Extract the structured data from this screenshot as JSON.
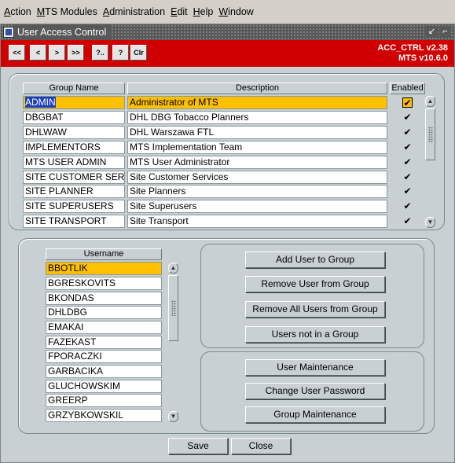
{
  "menu": [
    {
      "acc": "A",
      "rest": "ction"
    },
    {
      "acc": "M",
      "rest": "TS Modules"
    },
    {
      "acc": "A",
      "rest": "dministration"
    },
    {
      "acc": "E",
      "rest": "dit"
    },
    {
      "acc": "H",
      "rest": "elp"
    },
    {
      "acc": "W",
      "rest": "indow"
    }
  ],
  "window": {
    "title": "User Access Control",
    "controls": {
      "restore": "↙",
      "maximize": "⌐"
    }
  },
  "toolbar": {
    "buttons": [
      "<<",
      "<",
      ">",
      ">>",
      "?..",
      "?",
      "Clr"
    ],
    "version": "ACC_CTRL v2.38",
    "mts_version": "MTS v10.6.0"
  },
  "groups": {
    "headers": {
      "name": "Group Name",
      "description": "Description",
      "enabled": "Enabled"
    },
    "rows": [
      {
        "name": "ADMIN",
        "description": "Administrator of MTS",
        "enabled": "✔"
      },
      {
        "name": "DBGBAT",
        "description": "DHL DBG Tobacco Planners",
        "enabled": "✔"
      },
      {
        "name": "DHLWAW",
        "description": "DHL Warszawa FTL",
        "enabled": "✔"
      },
      {
        "name": "IMPLEMENTORS",
        "description": "MTS Implementation Team",
        "enabled": "✔"
      },
      {
        "name": "MTS USER ADMIN",
        "description": "MTS User Administrator",
        "enabled": "✔"
      },
      {
        "name": "SITE CUSTOMER SERV",
        "description": "Site Customer Services",
        "enabled": "✔"
      },
      {
        "name": "SITE PLANNER",
        "description": "Site Planners",
        "enabled": "✔"
      },
      {
        "name": "SITE SUPERUSERS",
        "description": "Site Superusers",
        "enabled": "✔"
      },
      {
        "name": "SITE TRANSPORT",
        "description": "Site Transport",
        "enabled": "✔"
      }
    ]
  },
  "users": {
    "header": "Username",
    "rows": [
      "BBOTLIK",
      "BGRESKOVITS",
      "BKONDAS",
      "DHLDBG",
      "EMAKAI",
      "FAZEKAST",
      "FPORACZKI",
      "GARBACIKA",
      "GLUCHOWSKIM",
      "GREERP",
      "GRZYBKOWSKIL"
    ]
  },
  "group_actions": [
    "Add User to Group",
    "Remove User from Group",
    "Remove All Users from Group",
    "Users not in a Group"
  ],
  "user_actions": [
    "User Maintenance",
    "Change User Password",
    "Group Maintenance"
  ],
  "footer": {
    "save": "Save",
    "close": "Close"
  },
  "colors": {
    "toolbar": "#d00000",
    "selected_row": "#ffc000",
    "highlight": "#1c3fbd"
  }
}
